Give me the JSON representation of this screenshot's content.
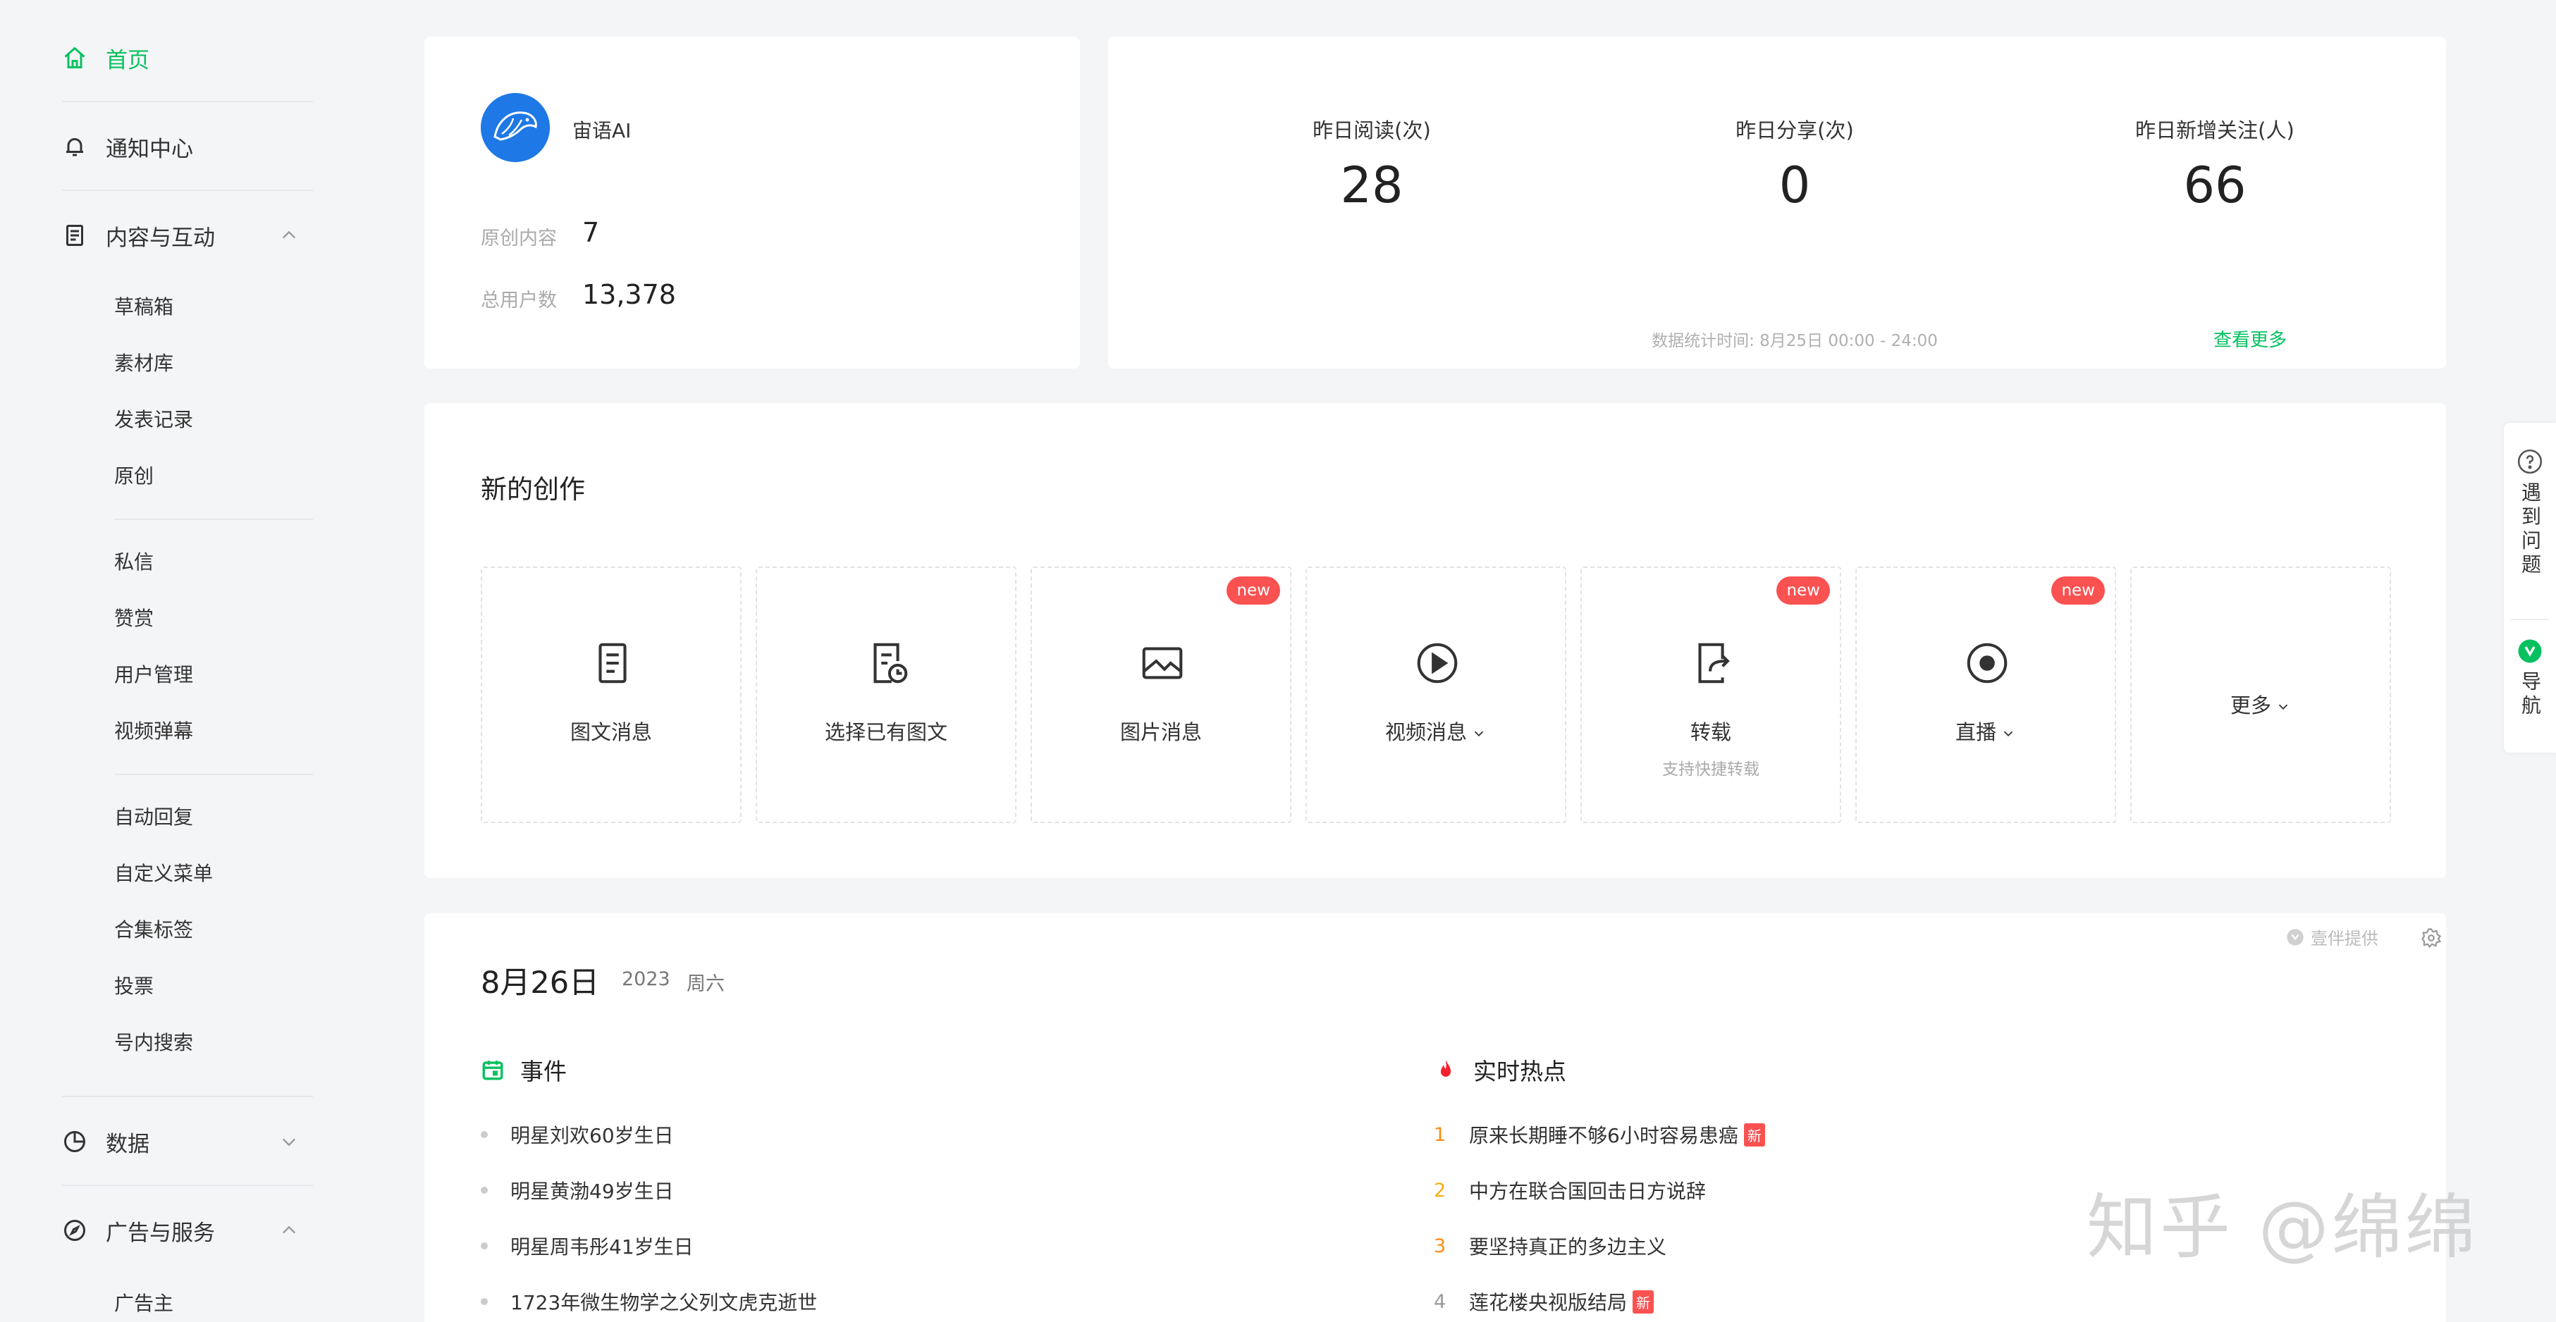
{
  "sidebar": {
    "home": "首页",
    "notifications": "通知中心",
    "content_group": "内容与互动",
    "content_items": [
      "草稿箱",
      "素材库",
      "发表记录",
      "原创"
    ],
    "interaction_items": [
      "私信",
      "赞赏",
      "用户管理",
      "视频弹幕"
    ],
    "feature_items": [
      "自动回复",
      "自定义菜单",
      "合集标签",
      "投票",
      "号内搜索"
    ],
    "data_group": "数据",
    "ads_group": "广告与服务",
    "ads_items": [
      "广告主"
    ]
  },
  "profile": {
    "name": "宙语AI",
    "original_label": "原创内容",
    "original_value": "7",
    "users_label": "总用户数",
    "users_value": "13,378"
  },
  "stats": {
    "reads_label": "昨日阅读(次)",
    "reads_value": "28",
    "shares_label": "昨日分享(次)",
    "shares_value": "0",
    "follows_label": "昨日新增关注(人)",
    "follows_value": "66",
    "time_note": "数据统计时间: 8月25日 00:00 - 24:00",
    "see_more": "查看更多"
  },
  "create": {
    "title": "新的创作",
    "new_badge": "new",
    "tiles": [
      {
        "label": "图文消息",
        "icon": "document-icon"
      },
      {
        "label": "选择已有图文",
        "icon": "document-clock-icon"
      },
      {
        "label": "图片消息",
        "icon": "image-icon"
      },
      {
        "label": "视频消息",
        "icon": "play-circle-icon"
      },
      {
        "label": "转载",
        "sub": "支持快捷转载",
        "icon": "share-doc-icon"
      },
      {
        "label": "直播",
        "icon": "live-icon"
      }
    ],
    "more": "更多"
  },
  "calendar": {
    "date": "8月26日",
    "year": "2023",
    "weekday": "周六",
    "provider": "壹伴提供",
    "events_title": "事件",
    "events": [
      "明星刘欢60岁生日",
      "明星黄渤49岁生日",
      "明星周韦彤41岁生日",
      "1723年微生物学之父列文虎克逝世"
    ],
    "hot_title": "实时热点",
    "hot": [
      {
        "rank": "1",
        "text": "原来长期睡不够6小时容易患癌",
        "tag": "新",
        "color": "#fa8c16"
      },
      {
        "rank": "2",
        "text": "中方在联合国回击日方说辞",
        "tag": "",
        "color": "#faad14"
      },
      {
        "rank": "3",
        "text": "要坚持真正的多边主义",
        "tag": "",
        "color": "#fa8c16"
      },
      {
        "rank": "4",
        "text": "莲花楼央视版结局",
        "tag": "新",
        "color": "#999999"
      }
    ]
  },
  "float": {
    "help": "遇到问题",
    "nav": "导航"
  },
  "watermark": "知乎 @绵绵",
  "colors": {
    "accent": "#07c160",
    "badge": "#fa5151",
    "avatar": "#1e78e6"
  }
}
